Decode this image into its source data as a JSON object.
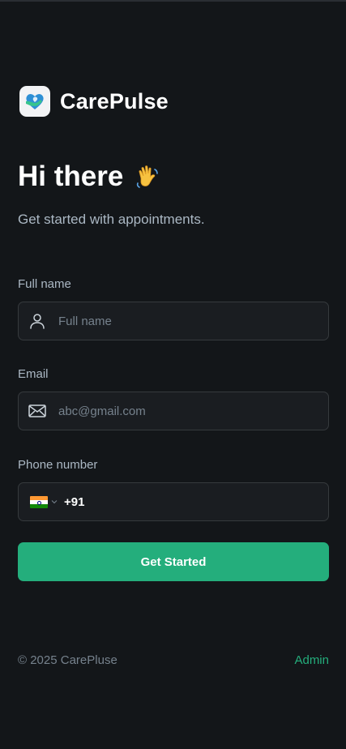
{
  "brand": {
    "name": "CarePulse",
    "logo_icon": "heart-hands-icon",
    "accent_color": "#24ae7c"
  },
  "greeting": {
    "title": "Hi there",
    "emoji_icon": "waving-hand-icon"
  },
  "subtitle": "Get started with appointments.",
  "form": {
    "full_name": {
      "label": "Full name",
      "placeholder": "Full name",
      "icon": "user-icon"
    },
    "email": {
      "label": "Email",
      "placeholder": "abc@gmail.com",
      "icon": "envelope-icon"
    },
    "phone": {
      "label": "Phone number",
      "country_flag_icon": "india-flag-icon",
      "dial_code": "+91",
      "value": ""
    },
    "submit_label": "Get Started"
  },
  "footer": {
    "copyright": "© 2025 CarePluse",
    "admin_link": "Admin"
  },
  "colors": {
    "background": "#131619",
    "input_background": "#1a1d21",
    "input_border": "#363a3d",
    "muted_text": "#76828d",
    "label_text": "#abb8c4",
    "primary_button": "#24ae7c"
  }
}
